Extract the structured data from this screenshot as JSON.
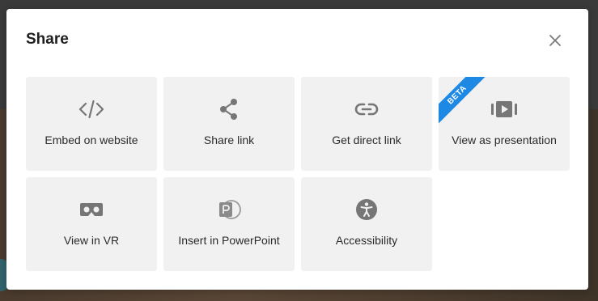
{
  "dialog": {
    "title": "Share",
    "close_icon": "close-icon"
  },
  "tiles": [
    {
      "label": "Embed on website",
      "icon": "code-icon"
    },
    {
      "label": "Share link",
      "icon": "share-icon"
    },
    {
      "label": "Get direct link",
      "icon": "link-icon"
    },
    {
      "label": "View as presentation",
      "icon": "presentation-icon",
      "badge": "BETA"
    },
    {
      "label": "View in VR",
      "icon": "vr-headset-icon"
    },
    {
      "label": "Insert in PowerPoint",
      "icon": "powerpoint-icon"
    },
    {
      "label": "Accessibility",
      "icon": "accessibility-icon"
    }
  ],
  "colors": {
    "tile_bg": "#f1f1f1",
    "icon": "#767676",
    "badge": "#1e88e5"
  }
}
